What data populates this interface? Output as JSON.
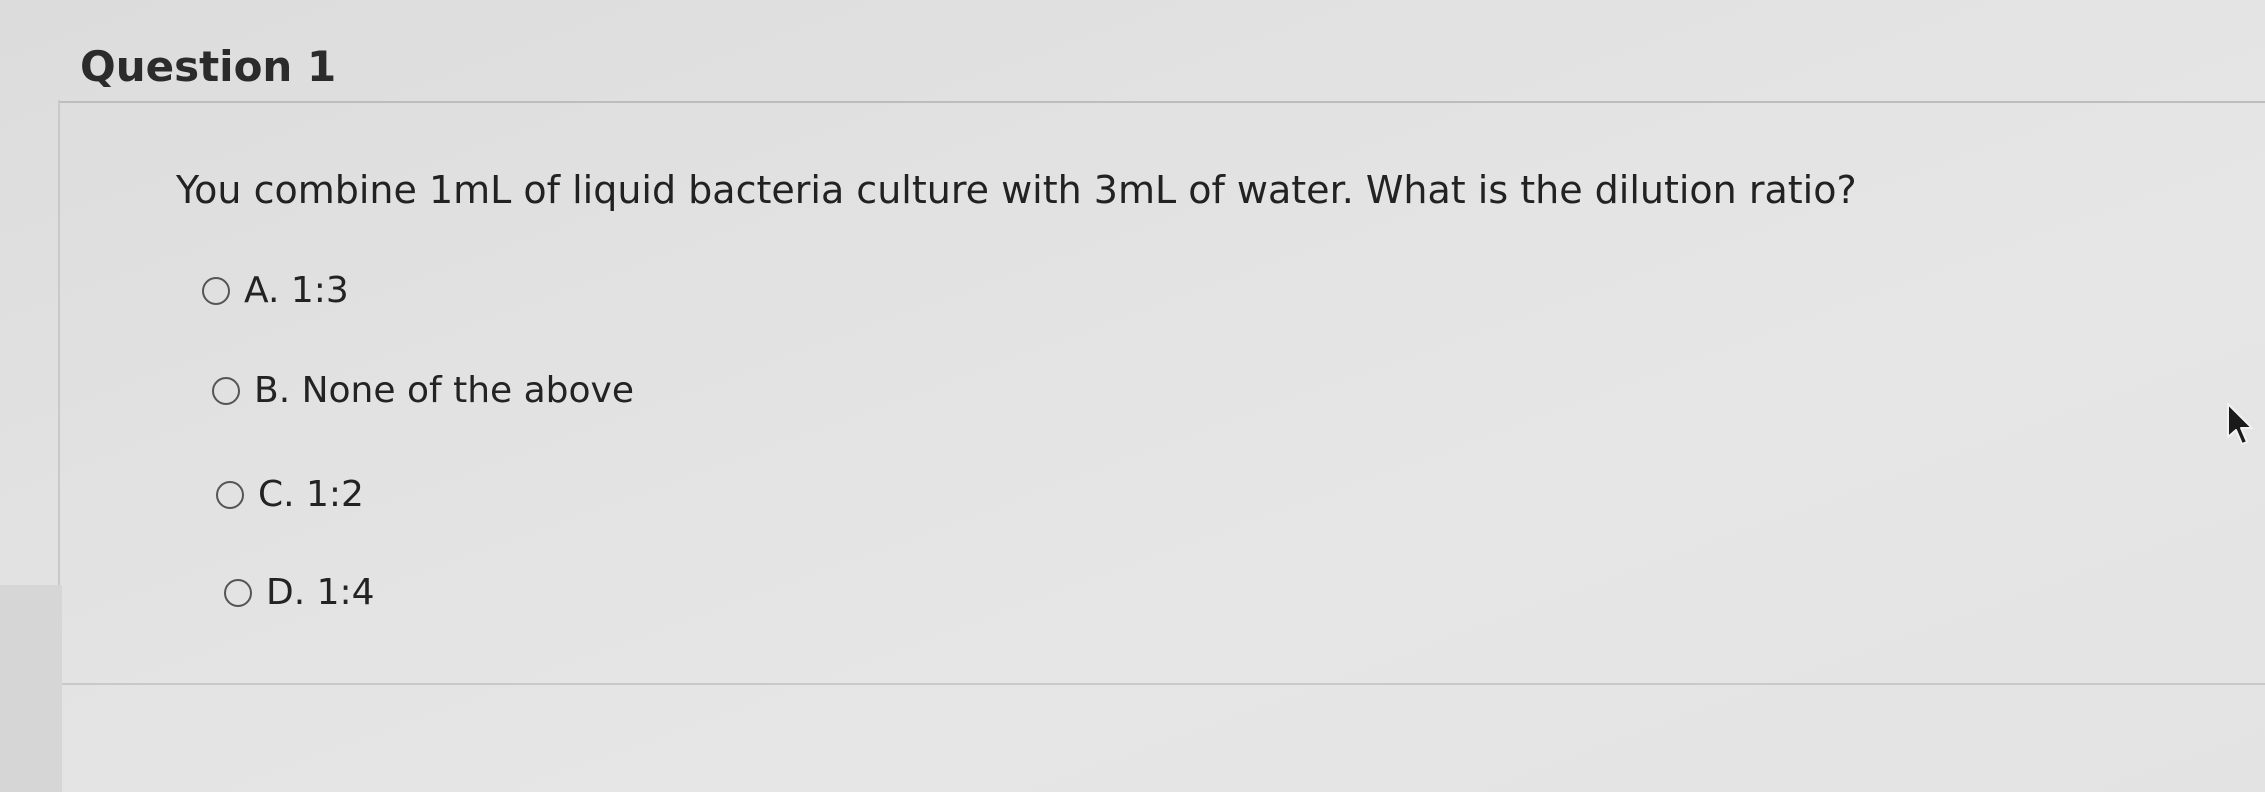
{
  "question": {
    "title": "Question 1",
    "prompt": "You combine 1mL of liquid bacteria culture with 3mL of water. What is the dilution ratio?"
  },
  "options": [
    {
      "label": "A. 1:3",
      "selected": false
    },
    {
      "label": "B. None of the above",
      "selected": false
    },
    {
      "label": "C. 1:2",
      "selected": false
    },
    {
      "label": "D. 1:4",
      "selected": false
    }
  ],
  "icons": {
    "radio": "radio-unchecked-icon",
    "cursor": "mouse-pointer-icon"
  },
  "colors": {
    "background": "#e2e2e2",
    "text": "#222222",
    "rule": "#bdbdbd"
  }
}
